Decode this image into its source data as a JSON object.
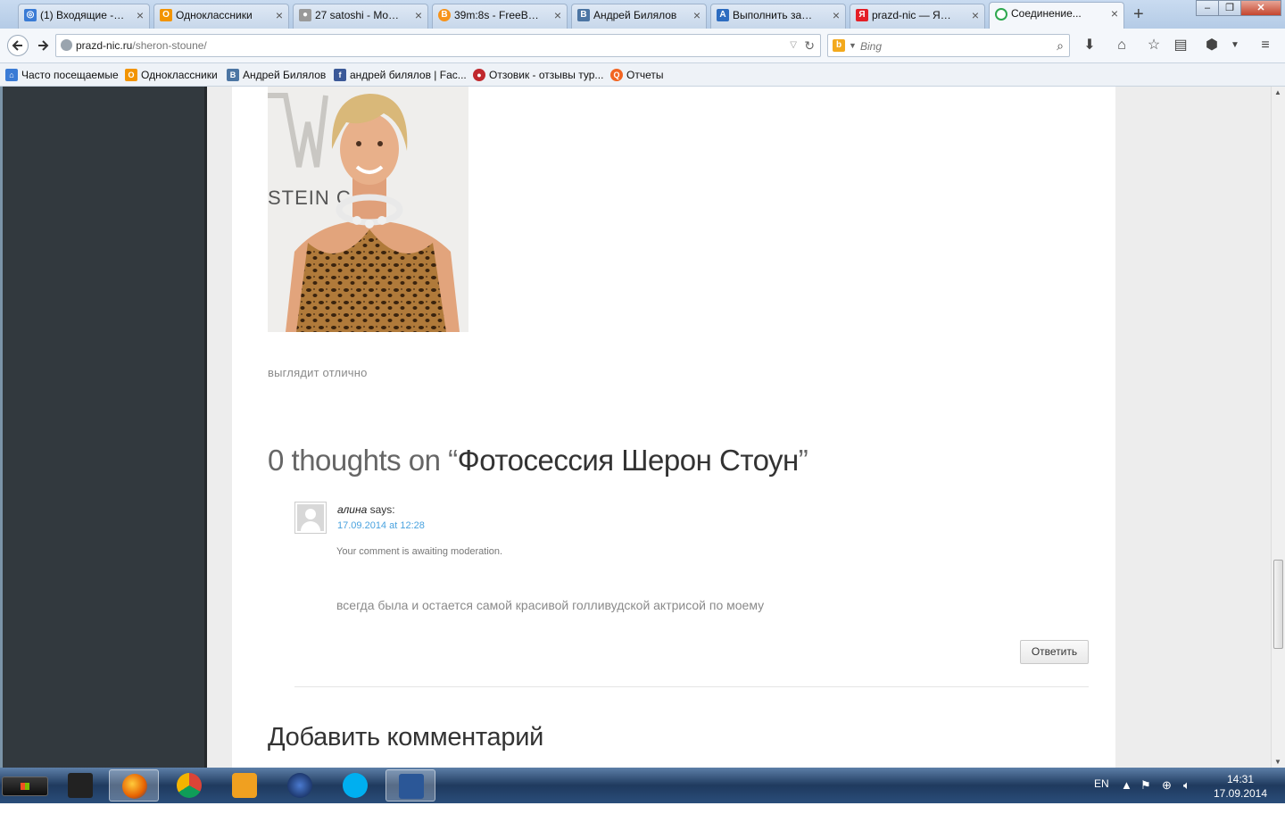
{
  "tabs": [
    {
      "title": "(1) Входящие - ...",
      "fav_color": "#3a7bd5",
      "fav_glyph": "◎"
    },
    {
      "title": "Одноклассники",
      "fav_color": "#f29400",
      "fav_glyph": "О"
    },
    {
      "title": "27 satoshi - Moo...",
      "fav_color": "#999999",
      "fav_glyph": "●"
    },
    {
      "title": "39m:8s - FreeBit...",
      "fav_color": "#f7931a",
      "fav_glyph": "B"
    },
    {
      "title": "Андрей Билялов",
      "fav_color": "#4c75a3",
      "fav_glyph": "В"
    },
    {
      "title": "Выполнить зада...",
      "fav_color": "#2d6cc0",
      "fav_glyph": "A"
    },
    {
      "title": "prazd-nic — Янд...",
      "fav_color": "#e41e26",
      "fav_glyph": "Я"
    },
    {
      "title": "Соединение...",
      "fav_color": "#2fa84f",
      "fav_glyph": "○"
    }
  ],
  "newtab_label": "+",
  "url": {
    "host": "prazd-nic.ru",
    "path": "/sheron-stoune/"
  },
  "search": {
    "placeholder": "Bing",
    "engine_glyph": "b"
  },
  "bookmarks": [
    {
      "label": "Часто посещаемые",
      "color": "#3a7bd5",
      "glyph": "⌂"
    },
    {
      "label": "Одноклассники",
      "color": "#f29400",
      "glyph": "О"
    },
    {
      "label": "Андрей Билялов",
      "color": "#4c75a3",
      "glyph": "В"
    },
    {
      "label": "андрей билялов | Fac...",
      "color": "#3b5998",
      "glyph": "f"
    },
    {
      "label": "Отзовик - отзывы тур...",
      "color": "#c0282d",
      "glyph": "●"
    },
    {
      "label": "Отчеты",
      "color": "#f26522",
      "glyph": "Q"
    }
  ],
  "post": {
    "caption": "выглядит отлично",
    "thoughts_prefix": "0 thoughts on “",
    "thoughts_title": "Фотосессия Шерон Стоун",
    "thoughts_suffix": "”",
    "photo_bg_text": "STEIN C"
  },
  "comment": {
    "author": "алина",
    "says": " says:",
    "date": "17.09.2014 at 12:28",
    "awaiting": "Your comment is awaiting moderation.",
    "text": "всегда была и остается самой красивой голливудской актрисой по моему",
    "reply_label": "Ответить"
  },
  "add_comment_title": "Добавить комментарий",
  "taskbar": {
    "lang": "EN",
    "time": "14:31",
    "date": "17.09.2014",
    "apps": [
      {
        "name": "files",
        "color": "#222222"
      },
      {
        "name": "firefox",
        "color": "#e66000"
      },
      {
        "name": "chrome",
        "color": "#4caf50"
      },
      {
        "name": "eye-app",
        "color": "#f0a020"
      },
      {
        "name": "media-player",
        "color": "#1b3b7a"
      },
      {
        "name": "skype",
        "color": "#00aff0"
      },
      {
        "name": "word",
        "color": "#2b5797"
      }
    ]
  }
}
